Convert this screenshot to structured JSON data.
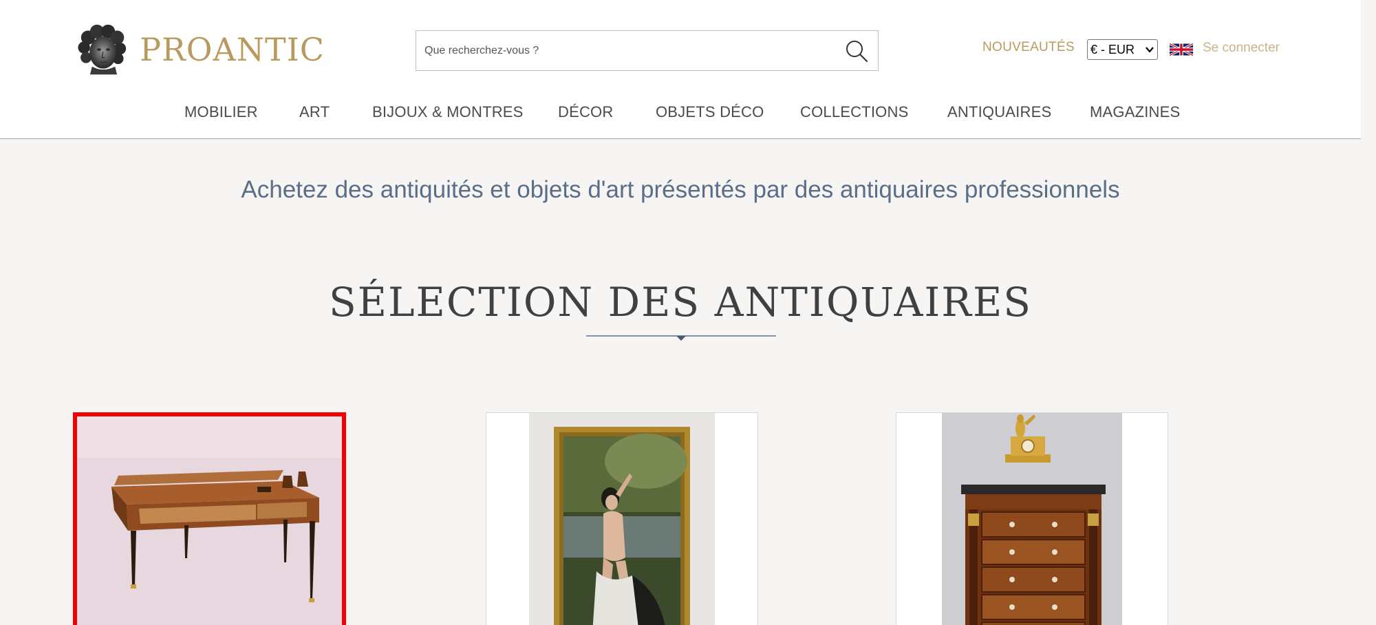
{
  "header": {
    "logo_text": "PROANTIC",
    "search": {
      "placeholder": "Que recherchez-vous ?",
      "value": ""
    },
    "new_label": "NOUVEAUTÉS",
    "currency": {
      "selected": "€ - EUR"
    },
    "login_label": "Se connecter",
    "nav": [
      {
        "label": "MOBILIER"
      },
      {
        "label": "ART"
      },
      {
        "label": "BIJOUX & MONTRES"
      },
      {
        "label": "DÉCOR"
      },
      {
        "label": "OBJETS DÉCO"
      },
      {
        "label": "COLLECTIONS"
      },
      {
        "label": "ANTIQUAIRES"
      },
      {
        "label": "MAGAZINES"
      }
    ]
  },
  "main": {
    "tagline": "Achetez des antiquités et objets d'art présentés par des antiquaires professionnels",
    "section_title": "SÉLECTION DES ANTIQUAIRES",
    "cards": [
      {
        "subject": "table-desk"
      },
      {
        "subject": "painting-nude"
      },
      {
        "subject": "chest-clock"
      }
    ]
  },
  "colors": {
    "brand_gold": "#b99a5e",
    "background": "#f6f5f3",
    "tagline_blue": "#5a6e88",
    "selection_red": "#f00000"
  },
  "icons": [
    "logo-bust-icon",
    "search-icon",
    "chevron-down-icon",
    "uk-flag-icon"
  ]
}
